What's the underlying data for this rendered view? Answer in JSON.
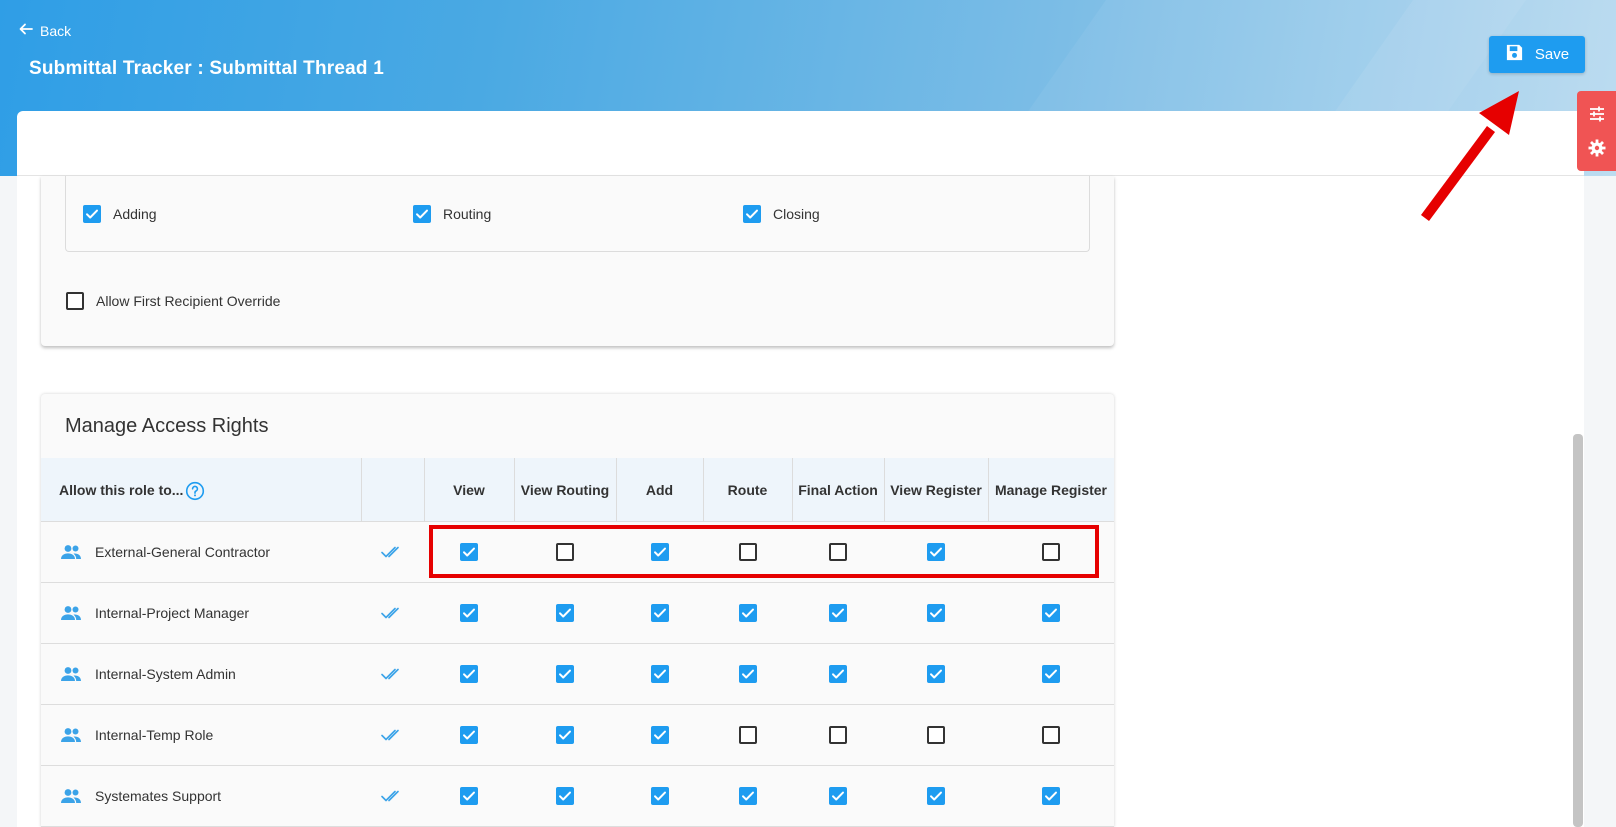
{
  "header": {
    "back_label": "Back",
    "title": "Submittal Tracker : Submittal Thread 1",
    "save_label": "Save"
  },
  "notifications": {
    "options": [
      {
        "label": "Adding",
        "checked": true
      },
      {
        "label": "Routing",
        "checked": true
      },
      {
        "label": "Closing",
        "checked": true
      }
    ],
    "override": {
      "label": "Allow First Recipient Override",
      "checked": false
    }
  },
  "access_rights": {
    "title": "Manage Access Rights",
    "header_label": "Allow this role to...",
    "columns": [
      "View",
      "View Routing",
      "Add",
      "Route",
      "Final Action",
      "View Register",
      "Manage Register"
    ],
    "rows": [
      {
        "role": "External-General Contractor",
        "values": [
          true,
          false,
          true,
          false,
          false,
          true,
          false
        ]
      },
      {
        "role": "Internal-Project Manager",
        "values": [
          true,
          true,
          true,
          true,
          true,
          true,
          true
        ]
      },
      {
        "role": "Internal-System Admin",
        "values": [
          true,
          true,
          true,
          true,
          true,
          true,
          true
        ]
      },
      {
        "role": "Internal-Temp Role",
        "values": [
          true,
          true,
          true,
          false,
          false,
          false,
          false
        ]
      },
      {
        "role": "Systemates Support",
        "values": [
          true,
          true,
          true,
          true,
          true,
          true,
          true
        ]
      }
    ]
  },
  "colors": {
    "accent": "#1e9cf0",
    "highlight": "#e60000",
    "side_tools": "#f05454"
  },
  "icons": [
    "arrow-left-icon",
    "floppy-disk-icon",
    "sliders-icon",
    "gear-icon",
    "help-circle-icon",
    "users-icon",
    "double-check-icon"
  ]
}
